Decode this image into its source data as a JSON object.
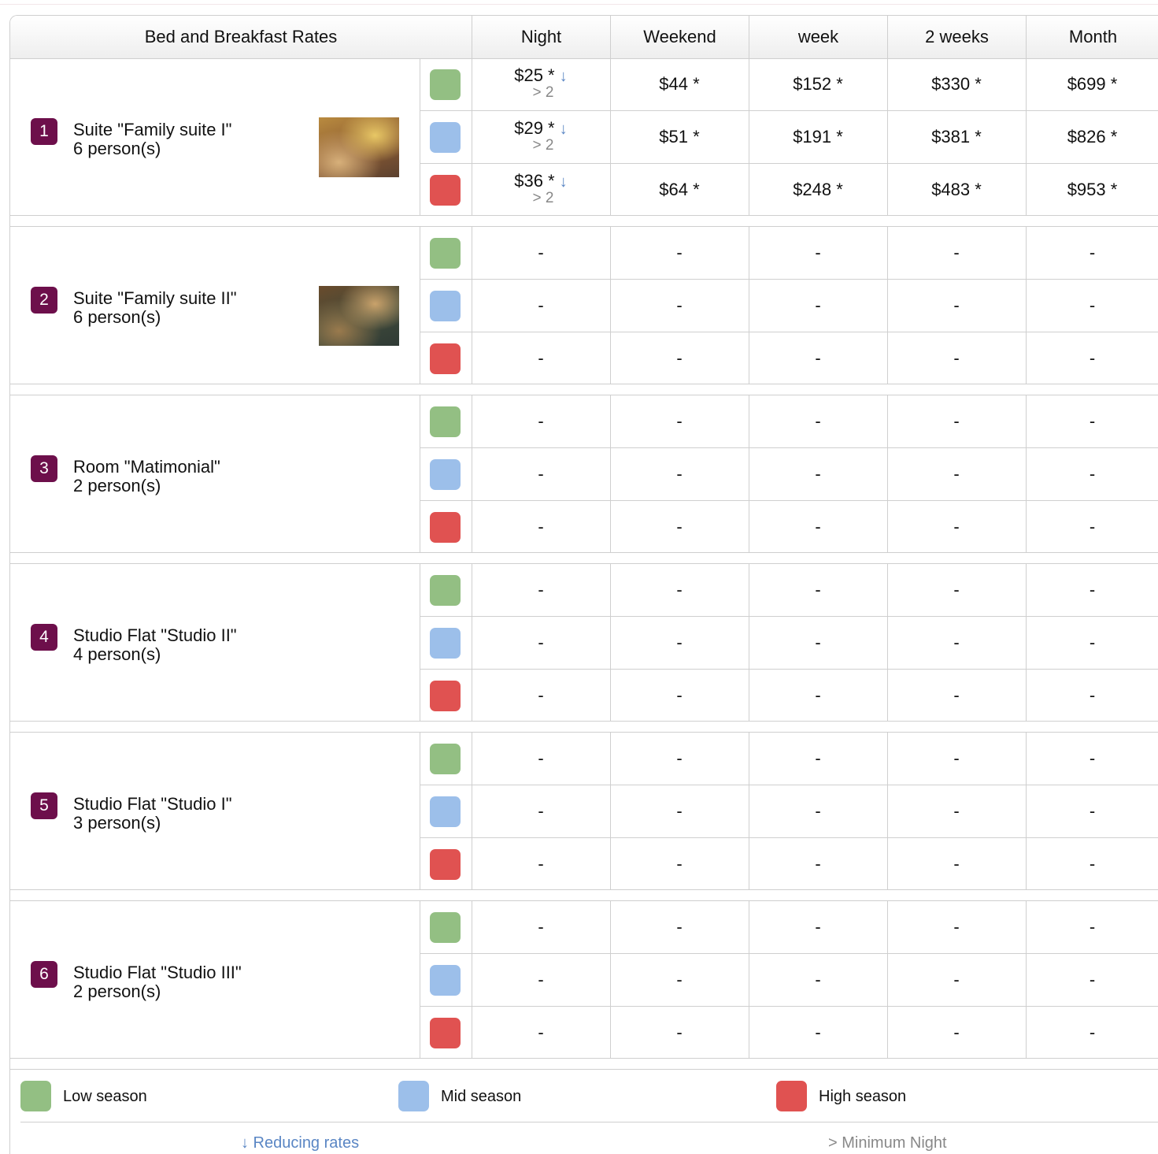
{
  "table": {
    "title": "Bed and Breakfast Rates",
    "columns": [
      "Night",
      "Weekend",
      "week",
      "2 weeks",
      "Month"
    ]
  },
  "colors": {
    "low": "#93bf83",
    "mid": "#9cbfea",
    "high": "#e05251",
    "badge": "#6d0f4b",
    "reduce": "#5a86c4"
  },
  "icons": {
    "reducing": "↓",
    "minimum": ">"
  },
  "rooms": [
    {
      "number": "1",
      "name": "Suite \"Family suite I\"",
      "capacity": "6 person(s)",
      "has_photo": true,
      "rates": [
        {
          "season": "low",
          "night": "$25 *",
          "night_min": "> 2",
          "weekend": "$44 *",
          "week": "$152 *",
          "two_weeks": "$330 *",
          "month": "$699 *"
        },
        {
          "season": "mid",
          "night": "$29 *",
          "night_min": "> 2",
          "weekend": "$51 *",
          "week": "$191 *",
          "two_weeks": "$381 *",
          "month": "$826 *"
        },
        {
          "season": "high",
          "night": "$36 *",
          "night_min": "> 2",
          "weekend": "$64 *",
          "week": "$248 *",
          "two_weeks": "$483 *",
          "month": "$953 *"
        }
      ]
    },
    {
      "number": "2",
      "name": "Suite \"Family suite II\"",
      "capacity": "6 person(s)",
      "has_photo": true,
      "rates": [
        {
          "season": "low",
          "night": "-",
          "weekend": "-",
          "week": "-",
          "two_weeks": "-",
          "month": "-"
        },
        {
          "season": "mid",
          "night": "-",
          "weekend": "-",
          "week": "-",
          "two_weeks": "-",
          "month": "-"
        },
        {
          "season": "high",
          "night": "-",
          "weekend": "-",
          "week": "-",
          "two_weeks": "-",
          "month": "-"
        }
      ]
    },
    {
      "number": "3",
      "name": "Room \"Matimonial\"",
      "capacity": "2 person(s)",
      "has_photo": false,
      "rates": [
        {
          "season": "low",
          "night": "-",
          "weekend": "-",
          "week": "-",
          "two_weeks": "-",
          "month": "-"
        },
        {
          "season": "mid",
          "night": "-",
          "weekend": "-",
          "week": "-",
          "two_weeks": "-",
          "month": "-"
        },
        {
          "season": "high",
          "night": "-",
          "weekend": "-",
          "week": "-",
          "two_weeks": "-",
          "month": "-"
        }
      ]
    },
    {
      "number": "4",
      "name": "Studio Flat \"Studio II\"",
      "capacity": "4 person(s)",
      "has_photo": false,
      "rates": [
        {
          "season": "low",
          "night": "-",
          "weekend": "-",
          "week": "-",
          "two_weeks": "-",
          "month": "-"
        },
        {
          "season": "mid",
          "night": "-",
          "weekend": "-",
          "week": "-",
          "two_weeks": "-",
          "month": "-"
        },
        {
          "season": "high",
          "night": "-",
          "weekend": "-",
          "week": "-",
          "two_weeks": "-",
          "month": "-"
        }
      ]
    },
    {
      "number": "5",
      "name": "Studio Flat \"Studio I\"",
      "capacity": "3 person(s)",
      "has_photo": false,
      "rates": [
        {
          "season": "low",
          "night": "-",
          "weekend": "-",
          "week": "-",
          "two_weeks": "-",
          "month": "-"
        },
        {
          "season": "mid",
          "night": "-",
          "weekend": "-",
          "week": "-",
          "two_weeks": "-",
          "month": "-"
        },
        {
          "season": "high",
          "night": "-",
          "weekend": "-",
          "week": "-",
          "two_weeks": "-",
          "month": "-"
        }
      ]
    },
    {
      "number": "6",
      "name": "Studio Flat \"Studio III\"",
      "capacity": "2 person(s)",
      "has_photo": false,
      "rates": [
        {
          "season": "low",
          "night": "-",
          "weekend": "-",
          "week": "-",
          "two_weeks": "-",
          "month": "-"
        },
        {
          "season": "mid",
          "night": "-",
          "weekend": "-",
          "week": "-",
          "two_weeks": "-",
          "month": "-"
        },
        {
          "season": "high",
          "night": "-",
          "weekend": "-",
          "week": "-",
          "two_weeks": "-",
          "month": "-"
        }
      ]
    }
  ],
  "legend": {
    "low": "Low season",
    "mid": "Mid season",
    "high": "High season",
    "reducing": "↓ Reducing rates",
    "minimum": "> Minimum Night"
  }
}
